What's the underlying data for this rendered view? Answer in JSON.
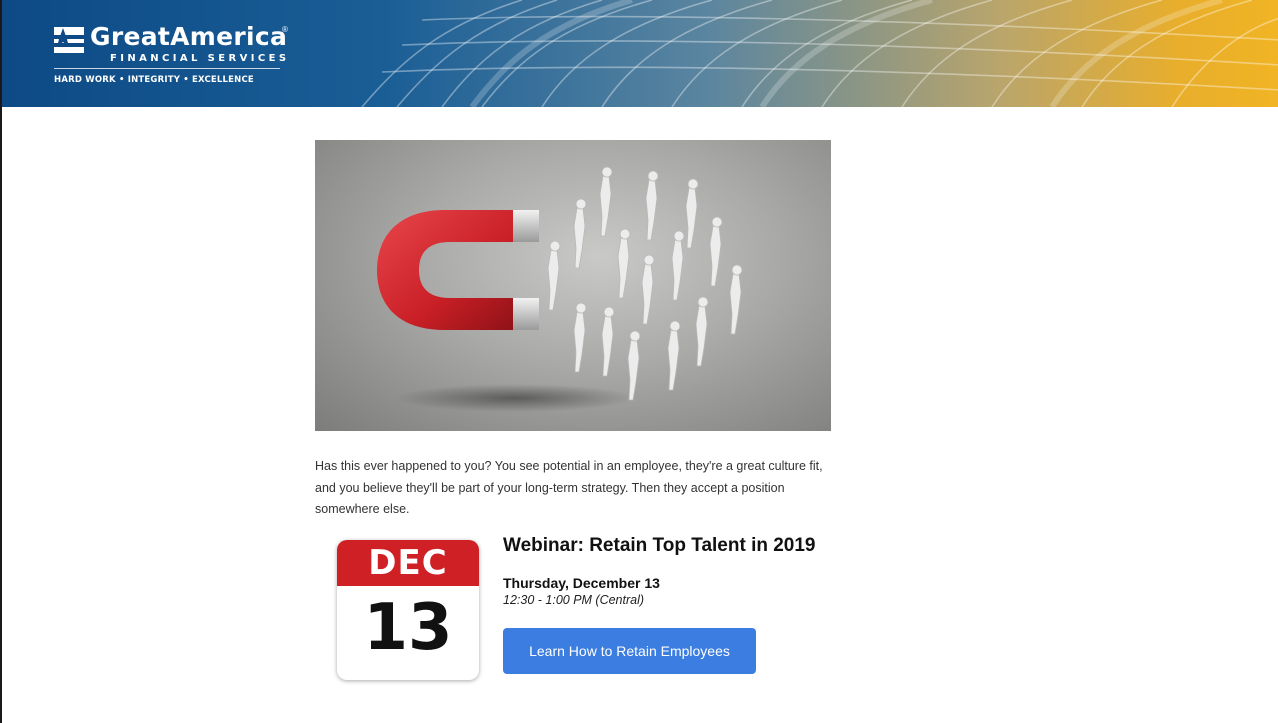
{
  "header": {
    "brand_name": "GreatAmerica",
    "registered_mark": "®",
    "brand_sub": "FINANCIAL SERVICES",
    "tagline": "HARD WORK • INTEGRITY • EXCELLENCE",
    "colors": {
      "left": "#0d4a86",
      "right": "#f1b424"
    }
  },
  "hero": {
    "image": "magnet-attracting-people-illustration",
    "colors": {
      "magnet": "#d2232a",
      "background": "#a9a9a7"
    }
  },
  "body": {
    "paragraph": "Has this ever happened to you? You see potential in an employee, they're a great culture fit, and you believe they'll be part of your long-term strategy. Then they accept a position somewhere else."
  },
  "event": {
    "calendar_month": "DEC",
    "calendar_day": "13",
    "title": "Webinar: Retain Top Talent in 2019",
    "date": "Thursday, December 13",
    "time": "12:30 - 1:00 PM (Central)",
    "cta_label": "Learn How to Retain Employees",
    "colors": {
      "calendar_red": "#cf2025",
      "button": "#3b7de0"
    }
  }
}
